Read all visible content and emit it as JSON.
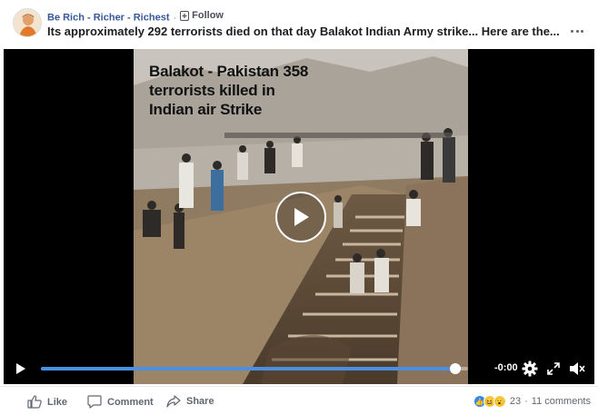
{
  "header": {
    "page_name": "Be Rich - Richer - Richest",
    "separator": "·",
    "follow_label": "Follow",
    "title": "Its approximately 292 terrorists died on that day Balakot Indian Army strike... Here are the...",
    "more_icon": "more-horizontal-icon"
  },
  "video": {
    "caption_lines": [
      "Balakot - Pakistan 358",
      "terrorists killed in",
      "Indian air Strike"
    ],
    "play_icon": "play-circle-icon",
    "controls": {
      "time": "-0:00",
      "progress_fraction": 0.97,
      "play_icon": "play-icon",
      "settings_icon": "gear-icon",
      "fullscreen_icon": "fullscreen-icon",
      "volume_icon": "volume-muted-icon",
      "accent": "#4a90e2"
    }
  },
  "actions": {
    "like_label": "Like",
    "comment_label": "Comment",
    "share_label": "Share",
    "reaction_count": "23",
    "separator": "·",
    "comments_label": "11 comments",
    "reaction_icons": [
      "like-reaction-icon",
      "haha-reaction-icon",
      "wow-reaction-icon"
    ]
  },
  "colors": {
    "link": "#385898",
    "text": "#1c1e21",
    "muted": "#606770"
  }
}
